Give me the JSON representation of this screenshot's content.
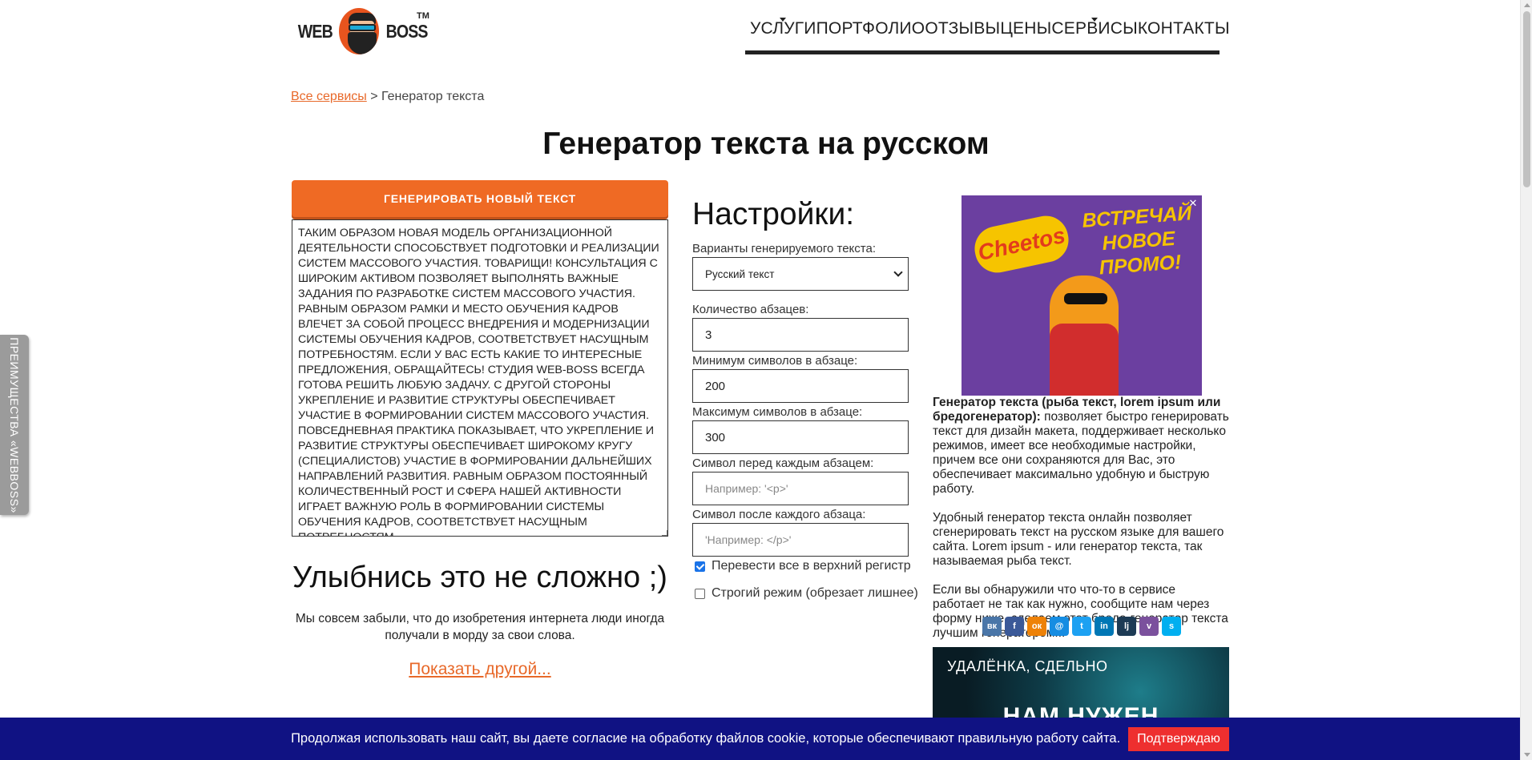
{
  "header": {
    "logo_word1": "WEB",
    "logo_word2": "BOSS",
    "logo_tm": "TM",
    "nav": [
      {
        "label": "УСЛУГИ",
        "has_dropdown": true
      },
      {
        "label": "ПОРТФОЛИО",
        "has_dropdown": false
      },
      {
        "label": "ОТЗЫВЫ",
        "has_dropdown": false
      },
      {
        "label": "ЦЕНЫ",
        "has_dropdown": false
      },
      {
        "label": "СЕРВИСЫ",
        "has_dropdown": true
      },
      {
        "label": "КОНТАКТЫ",
        "has_dropdown": false
      }
    ]
  },
  "breadcrumb": {
    "link": "Все сервисы",
    "separator": ">",
    "current": "Генератор текста"
  },
  "page_title": "Генератор текста на русском",
  "generator": {
    "button_label": "ГЕНЕРИРОВАТЬ НОВЫЙ ТЕКСТ",
    "output_text": "ТАКИМ ОБРАЗОМ НОВАЯ МОДЕЛЬ ОРГАНИЗАЦИОННОЙ ДЕЯТЕЛЬНОСТИ СПОСОБСТВУЕТ ПОДГОТОВКИ И РЕАЛИЗАЦИИ СИСТЕМ МАССОВОГО УЧАСТИЯ. ТОВАРИЩИ! КОНСУЛЬТАЦИЯ С ШИРОКИМ АКТИВОМ ПОЗВОЛЯЕТ ВЫПОЛНЯТЬ ВАЖНЫЕ ЗАДАНИЯ ПО РАЗРАБОТКЕ СИСТЕМ МАССОВОГО УЧАСТИЯ.\nРАВНЫМ ОБРАЗОМ РАМКИ И МЕСТО ОБУЧЕНИЯ КАДРОВ ВЛЕЧЕТ ЗА СОБОЙ ПРОЦЕСС ВНЕДРЕНИЯ И МОДЕРНИЗАЦИИ СИСТЕМЫ ОБУЧЕНИЯ КАДРОВ, СООТВЕТСТВУЕТ НАСУЩНЫМ ПОТРЕБНОСТЯМ. ЕСЛИ У ВАС ЕСТЬ КАКИЕ ТО ИНТЕРЕСНЫЕ ПРЕДЛОЖЕНИЯ, ОБРАЩАЙТЕСЬ! СТУДИЯ WEB-BOSS ВСЕГДА ГОТОВА РЕШИТЬ ЛЮБУЮ ЗАДАЧУ. С ДРУГОЙ СТОРОНЫ УКРЕПЛЕНИЕ И РАЗВИТИЕ СТРУКТУРЫ ОБЕСПЕЧИВАЕТ УЧАСТИЕ В ФОРМИРОВАНИИ СИСТЕМ МАССОВОГО УЧАСТИЯ.\nПОВСЕДНЕВНАЯ ПРАКТИКА ПОКАЗЫВАЕТ, ЧТО УКРЕПЛЕНИЕ И РАЗВИТИЕ СТРУКТУРЫ ОБЕСПЕЧИВАЕТ ШИРОКОМУ КРУГУ (СПЕЦИАЛИСТОВ) УЧАСТИЕ В ФОРМИРОВАНИИ ДАЛЬНЕЙШИХ НАПРАВЛЕНИЙ РАЗВИТИЯ. РАВНЫМ ОБРАЗОМ ПОСТОЯННЫЙ КОЛИЧЕСТВЕННЫЙ РОСТ И СФЕРА НАШЕЙ АКТИВНОСТИ ИГРАЕТ ВАЖНУЮ РОЛЬ В ФОРМИРОВАНИИ СИСТЕМЫ ОБУЧЕНИЯ КАДРОВ, СООТВЕТСТВУЕТ НАСУЩНЫМ ПОТРЕБНОСТЯМ."
  },
  "smile": {
    "title": "Улыбнись это не сложно ;)",
    "text": "Мы совсем забыли, что до изобретения интернета люди иногда получали в морду за свои слова.",
    "link": "Показать другой..."
  },
  "settings": {
    "title": "Настройки:",
    "variant_label": "Варианты генерируемого текста:",
    "variant_value": "Русский текст",
    "paragraphs_label": "Количество абзацев:",
    "paragraphs_value": "3",
    "min_label": "Минимум символов в абзаце:",
    "min_value": "200",
    "max_label": "Максимум символов в абзаце:",
    "max_value": "300",
    "before_label": "Символ перед каждым абзацем:",
    "before_placeholder": "Например: '<p>'",
    "after_label": "Символ после каждого абзаца:",
    "after_placeholder": "'Например: </p>'",
    "uppercase_label": "Перевести все в верхний регистр",
    "uppercase_checked": true,
    "strict_label": "Строгий режим (обрезает лишнее)",
    "strict_checked": false
  },
  "ad": {
    "brand": "Cheetos",
    "promo": "ВСТРЕЧАЙ НОВОЕ ПРОМО!",
    "close": "✕"
  },
  "description": {
    "p1_bold": "Генератор текста (рыба текст, lorem ipsum или бредогенератор):",
    "p1_rest": " позволяет быстро генерировать текст для дизайн макета, поддерживает несколько режимов, имеет все необходимые настройки, причем все они сохраняются для Вас, это обеспечивает максимально удобную и быструю работу.",
    "p2": "Удобный генератор текста онлайн позволяет сгенерировать текст на русском языке для вашего сайта. Lorem ipsum - или генератор текста, так называемая рыба текст.",
    "p3": "Если вы обнаружили что что-то в сервисе работает не так как нужно, сообщите нам через форму ниже, сделаем этот бредо-генератор текста лучшим генератором!!!"
  },
  "share": [
    {
      "name": "vk-icon",
      "glyph": "вк",
      "color": "#4a76a8"
    },
    {
      "name": "facebook-icon",
      "glyph": "f",
      "color": "#3b5998"
    },
    {
      "name": "odnoklassniki-icon",
      "glyph": "ок",
      "color": "#ee8208"
    },
    {
      "name": "moimir-icon",
      "glyph": "@",
      "color": "#168de2"
    },
    {
      "name": "twitter-icon",
      "glyph": "t",
      "color": "#1da1f2"
    },
    {
      "name": "linkedin-icon",
      "glyph": "in",
      "color": "#0077b5"
    },
    {
      "name": "livejournal-icon",
      "glyph": "lj",
      "color": "#1d3b55"
    },
    {
      "name": "viber-icon",
      "glyph": "v",
      "color": "#7b519d"
    },
    {
      "name": "skype-icon",
      "glyph": "s",
      "color": "#00aff0"
    }
  ],
  "banner": {
    "line1": "УДАЛЁНКА, СДЕЛЬНО",
    "line2": "НАМ НУЖЕН"
  },
  "side_tab": "ПРЕИМУЩЕСТВА «WEBBOSS»",
  "cookie": {
    "text": "Продолжая использовать наш сайт, вы даете согласие на обработку файлов cookie, которые обеспечивают правильную работу сайта.",
    "button": "Подтверждаю"
  },
  "colors": {
    "accent": "#ef6a24",
    "link": "#e8692a",
    "cookie_bg": "#101283",
    "cookie_button": "#ee2f2f"
  }
}
